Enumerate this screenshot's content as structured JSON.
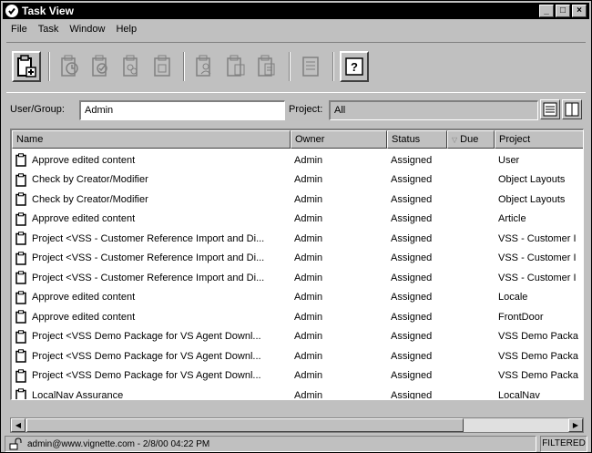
{
  "window": {
    "title": "Task View",
    "buttons": {
      "minimize": "_",
      "maximize": "□",
      "close": "×"
    }
  },
  "menu": [
    "File",
    "Task",
    "Window",
    "Help"
  ],
  "toolbar": {
    "buttons": [
      {
        "icon": "new-task-icon",
        "enabled": true
      },
      {
        "icon": "task-clock-icon",
        "enabled": false
      },
      {
        "icon": "task-edit-icon",
        "enabled": false
      },
      {
        "icon": "task-group-icon",
        "enabled": false
      },
      {
        "icon": "task-clipboard-icon",
        "enabled": false
      },
      {
        "icon": "task-users-icon",
        "enabled": false
      },
      {
        "icon": "task-forward-icon",
        "enabled": false
      },
      {
        "icon": "task-copy-icon",
        "enabled": false
      },
      {
        "icon": "notes-icon",
        "enabled": false
      },
      {
        "icon": "help-icon",
        "enabled": true,
        "label": "?"
      }
    ]
  },
  "filter": {
    "user_group_label": "User/Group:",
    "user_group_value": "Admin",
    "project_label": "Project:",
    "project_value": "All"
  },
  "table": {
    "columns": [
      "Name",
      "Owner",
      "Status",
      "Due",
      "Project"
    ],
    "sorted_column": "Due",
    "rows": [
      [
        "Approve edited content",
        "Admin",
        "Assigned",
        "",
        "User"
      ],
      [
        "Check by Creator/Modifier",
        "Admin",
        "Assigned",
        "",
        "Object Layouts"
      ],
      [
        "Check by Creator/Modifier",
        "Admin",
        "Assigned",
        "",
        "Object Layouts"
      ],
      [
        "Approve edited content",
        "Admin",
        "Assigned",
        "",
        "Article"
      ],
      [
        "Project <VSS - Customer Reference Import and Di...",
        "Admin",
        "Assigned",
        "",
        "VSS - Customer I"
      ],
      [
        "Project <VSS - Customer Reference Import and Di...",
        "Admin",
        "Assigned",
        "",
        "VSS - Customer I"
      ],
      [
        "Project <VSS - Customer Reference Import and Di...",
        "Admin",
        "Assigned",
        "",
        "VSS - Customer I"
      ],
      [
        "Approve edited content",
        "Admin",
        "Assigned",
        "",
        "Locale"
      ],
      [
        "Approve edited content",
        "Admin",
        "Assigned",
        "",
        "FrontDoor"
      ],
      [
        "Project <VSS Demo Package for VS Agent Downl...",
        "Admin",
        "Assigned",
        "",
        "VSS Demo Packa"
      ],
      [
        "Project <VSS Demo Package for VS Agent Downl...",
        "Admin",
        "Assigned",
        "",
        "VSS Demo Packa"
      ],
      [
        "Project <VSS Demo Package for VS Agent Downl...",
        "Admin",
        "Assigned",
        "",
        "VSS Demo Packa"
      ],
      [
        "LocalNav Assurance",
        "Admin",
        "Assigned",
        "",
        "LocalNav"
      ]
    ]
  },
  "scrollbar": {
    "left_arrow": "◀",
    "right_arrow": "▶"
  },
  "status": {
    "text": "admin@www.vignette.com - 2/8/00 04:22 PM",
    "filter_badge": "FILTERED"
  }
}
